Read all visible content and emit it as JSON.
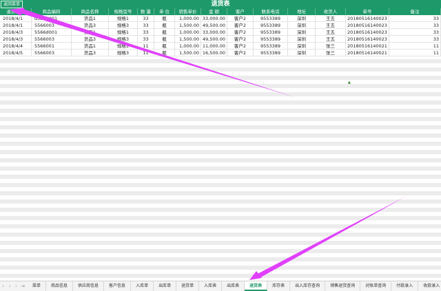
{
  "title": "退货表",
  "back_button": "返回菜单",
  "columns": [
    "退货日期",
    "商品编码",
    "商品名称",
    "规格型号",
    "数 量",
    "单 位",
    "销售单价",
    "金 额",
    "客户",
    "联系电话",
    "地址",
    "收货人",
    "单号",
    "备注"
  ],
  "rows": [
    [
      "2018/4/1",
      "d5566001",
      "货品1",
      "规格1",
      "33",
      "瓶",
      "1,000.00",
      "33,000.00",
      "客户2",
      "9553389",
      "深圳",
      "王五",
      "20180516140023",
      "33"
    ],
    [
      "2018/4/1",
      "5566003",
      "货品3",
      "规格3",
      "33",
      "瓶",
      "1,500.00",
      "49,500.00",
      "客户2",
      "9553389",
      "深圳",
      "王五",
      "20180516140023",
      "33"
    ],
    [
      "2018/4/3",
      "5566d001",
      "货品1",
      "规格1",
      "33",
      "瓶",
      "1,000.00",
      "33,000.00",
      "客户2",
      "9553389",
      "深圳",
      "王五",
      "20180516140023",
      "33"
    ],
    [
      "2018/4/3",
      "5566003",
      "货品3",
      "规格3",
      "33",
      "瓶",
      "1,500.00",
      "49,500.00",
      "客户2",
      "9553389",
      "深圳",
      "王五",
      "20180516140023",
      "33"
    ],
    [
      "2018/4/4",
      "5566001",
      "货品1",
      "规格1",
      "11",
      "瓶",
      "1,000.00",
      "11,000.00",
      "客户2",
      "9553389",
      "深圳",
      "张三",
      "20180516140021",
      "11"
    ],
    [
      "2018/4/5",
      "5566003",
      "货品3",
      "规格3",
      "11",
      "瓶",
      "1,500.00",
      "16,500.00",
      "客户2",
      "9553389",
      "深圳",
      "张三",
      "20180516140021",
      "11"
    ]
  ],
  "tabs": [
    "菜单",
    "商品信息",
    "供应商信息",
    "客户信息",
    "入库单",
    "出库单",
    "退货单",
    "入库表",
    "出库表",
    "退货表",
    "库存表",
    "出入库存查询",
    "销售退货查询",
    "对账单查询",
    "付款录入",
    "收款录入"
  ],
  "active_tab": "退货表",
  "nav_icons": [
    "first-sheet-icon",
    "prev-sheet-icon",
    "next-sheet-icon",
    "last-sheet-icon"
  ],
  "colors": {
    "header": "#1e9969",
    "arrow": "#e040fb",
    "stripe": "#ececec"
  }
}
